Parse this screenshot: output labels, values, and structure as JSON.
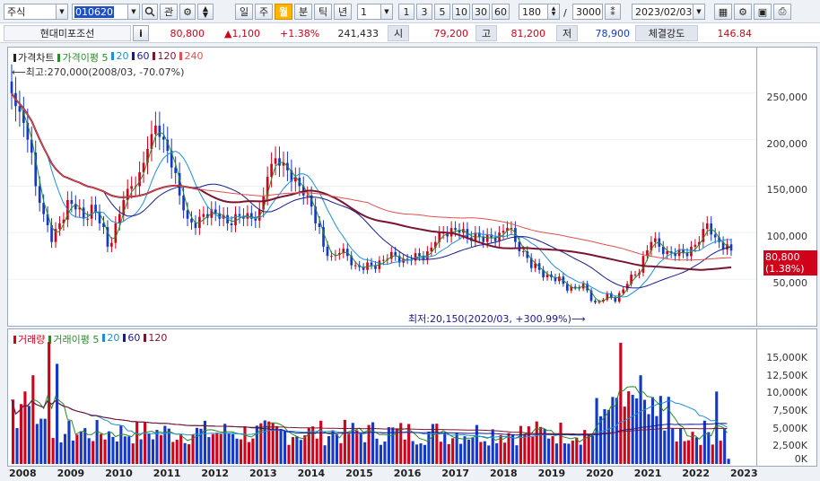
{
  "toolbar": {
    "market": "주식",
    "code": "010620",
    "search_icon": "search-icon",
    "gwan_label": "관",
    "periods": [
      "일",
      "주",
      "월",
      "분",
      "틱",
      "년"
    ],
    "selected_period": "월",
    "interval_value": "1",
    "interval_buttons": [
      "1",
      "3",
      "5",
      "10",
      "30",
      "60"
    ],
    "count_value": "180",
    "slash": "/",
    "total_value": "3000",
    "date_value": "2023/02/03"
  },
  "quote": {
    "name": "현대미포조선",
    "info_label": "i",
    "price": "80,800",
    "change": "▲1,100",
    "change_pct": "+1.38%",
    "volume": "241,433",
    "open_label": "시",
    "open": "79,200",
    "high_label": "고",
    "high": "81,200",
    "low_label": "저",
    "low": "78,900",
    "strength_label": "체결강도",
    "strength": "146.84"
  },
  "price_panel": {
    "legend": [
      {
        "label": "가격차트",
        "color": "#222222"
      },
      {
        "label": "가격이평 5",
        "color": "#2a8a2a"
      },
      {
        "label": "20",
        "color": "#1f8fd6"
      },
      {
        "label": "60",
        "color": "#1a1a8c"
      },
      {
        "label": "120",
        "color": "#7a1530"
      },
      {
        "label": "240",
        "color": "#e05050"
      }
    ],
    "high_note": "⟵최고:270,000(2008/03, -70.07%)",
    "low_note": "최저:20,150(2020/03, +300.99%)⟶",
    "y_ticks": [
      "250,000",
      "200,000",
      "150,000",
      "100,000",
      "50,000"
    ],
    "last_price_tag": "80,800",
    "last_pct_tag": "(1.38%)"
  },
  "volume_panel": {
    "legend": [
      {
        "label": "거래량",
        "color": "#d0021b"
      },
      {
        "label": "거래이평 5",
        "color": "#2a8a2a"
      },
      {
        "label": "20",
        "color": "#1f8fd6"
      },
      {
        "label": "60",
        "color": "#1a1a8c"
      },
      {
        "label": "120",
        "color": "#7a1530"
      }
    ],
    "y_ticks": [
      "15,000K",
      "12,500K",
      "10,000K",
      "7,500K",
      "5,000K",
      "2,500K",
      "0K"
    ]
  },
  "x_axis": [
    "2008",
    "2009",
    "2010",
    "2011",
    "2012",
    "2013",
    "2014",
    "2015",
    "2016",
    "2017",
    "2018",
    "2019",
    "2020",
    "2021",
    "2022",
    "2023"
  ],
  "colors": {
    "up": "#d0021b",
    "down": "#1438c8",
    "accent": "#ffb400"
  },
  "chart_data": {
    "type": "candlestick",
    "frequency": "monthly",
    "title": "",
    "approx_monthly_close_by_year": {
      "2008": [
        250000,
        230000,
        200000,
        150000,
        120000,
        90000
      ],
      "2009": [
        110000,
        135000,
        125000,
        115000,
        130000,
        110000
      ],
      "2010": [
        85000,
        110000,
        135000,
        150000,
        165000,
        190000
      ],
      "2011": [
        215000,
        200000,
        170000,
        140000,
        115000,
        105000
      ],
      "2012": [
        120000,
        125000,
        115000,
        110000,
        120000,
        115000
      ],
      "2013": [
        115000,
        125000,
        160000,
        180000,
        175000,
        155000
      ],
      "2014": [
        150000,
        140000,
        110000,
        85000,
        75000,
        78000
      ],
      "2015": [
        75000,
        65000,
        60000,
        65000,
        70000,
        72000
      ],
      "2016": [
        75000,
        72000,
        70000,
        75000,
        80000,
        90000
      ],
      "2017": [
        100000,
        105000,
        100000,
        95000,
        100000,
        90000
      ],
      "2018": [
        95000,
        100000,
        105000,
        90000,
        80000,
        62000
      ],
      "2019": [
        60000,
        55000,
        48000,
        45000,
        42000,
        40000
      ],
      "2020": [
        38000,
        25000,
        28000,
        30000,
        35000,
        45000
      ],
      "2021": [
        55000,
        75000,
        90000,
        85000,
        80000,
        75000
      ],
      "2022": [
        78000,
        85000,
        90000,
        110000,
        95000,
        82000
      ],
      "2023": [
        80800
      ]
    },
    "price_ylim": [
      0,
      270000
    ],
    "volume_ylim": [
      0,
      17000
    ],
    "volume_unit": "K"
  }
}
